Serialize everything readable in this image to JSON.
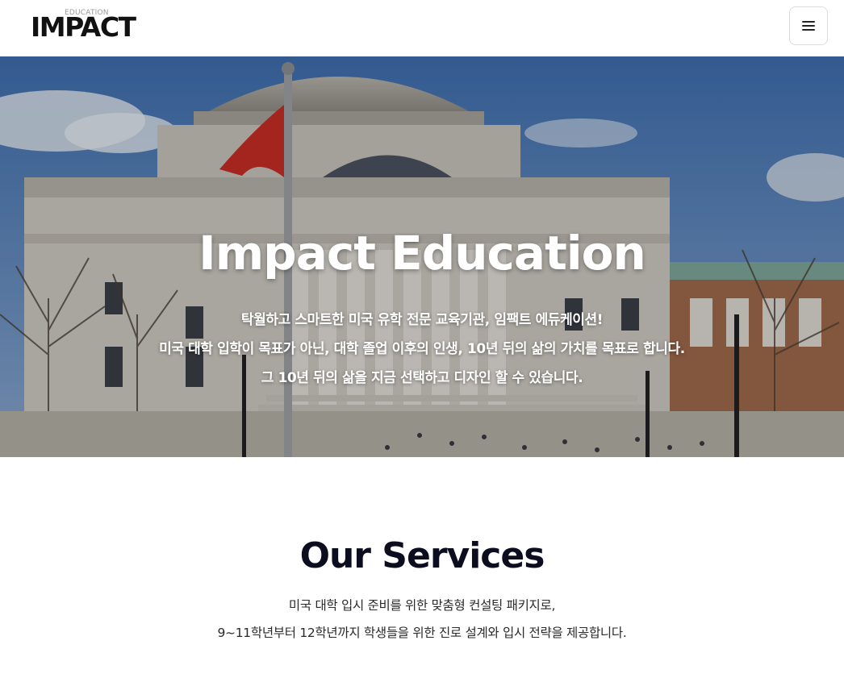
{
  "header": {
    "logo_small": "EDUCATION",
    "logo_main": "IMPACT",
    "menu_icon": "hamburger-menu-icon"
  },
  "hero": {
    "title": "Impact Education",
    "line1": "탁월하고 스마트한 미국 유학 전문 교육기관, 임팩트 에듀케이션!",
    "line2": "미국 대학 입학이 목표가 아닌, 대학 졸업 이후의 인생, 10년 뒤의 삶의 가치를 목표로 합니다.",
    "line3": "그 10년 뒤의 삶을 지금 선택하고 디자인 할 수 있습니다."
  },
  "services": {
    "title": "Our Services",
    "line1": "미국 대학 입시 준비를 위한 맞춤형 컨설팅 패키지로,",
    "line2": "9~11학년부터 12학년까지 학생들을 위한 진로 설계와 입시 전략을 제공합니다."
  },
  "colors": {
    "title_dark": "#0d0d20",
    "sky": "#5b82b8",
    "building": "#cfcbc2"
  }
}
